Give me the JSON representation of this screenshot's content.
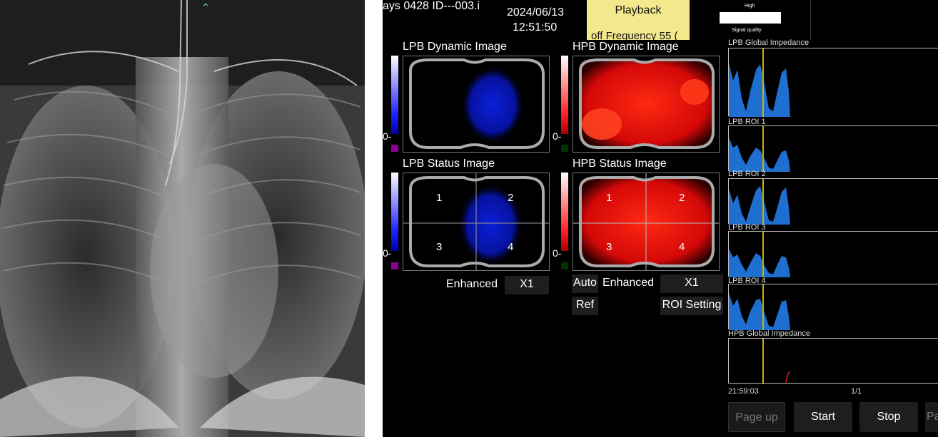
{
  "header": {
    "title": "ays 0428 ID---003.i",
    "date": "2024/06/13",
    "time": "12:51:50",
    "playback_label": "Playback",
    "frequency_text": "off Frequency 55 ("
  },
  "signal_quality": {
    "level_label": "High",
    "label": "Signal quality"
  },
  "panels": {
    "lpb_dynamic": {
      "title": "LPB Dynamic Image",
      "scale_zero": "0-"
    },
    "hpb_dynamic": {
      "title": "HPB Dynamic Image",
      "scale_zero": "0-"
    },
    "lpb_status": {
      "title": "LPB Status Image",
      "scale_zero": "0-",
      "quadrants": [
        "1",
        "2",
        "3",
        "4"
      ]
    },
    "hpb_status": {
      "title": "HPB Status Image",
      "scale_zero": "0-",
      "quadrants": [
        "1",
        "2",
        "3",
        "4"
      ]
    }
  },
  "controls": {
    "lpb_enhanced_label": "Enhanced",
    "lpb_zoom_value": "X1",
    "auto_label": "Auto",
    "hpb_enhanced_label": "Enhanced",
    "hpb_zoom_value": "X1",
    "ref_label": "Ref",
    "roi_setting_label": "ROI Setting"
  },
  "waveforms": {
    "lpb_global": "LPB Global Impedance",
    "roi1": "LPB ROI 1",
    "roi2": "LPB ROI 2",
    "roi3": "LPB ROI 3",
    "roi4": "LPB ROI 4",
    "hpb_global": "HPB Global Impedance",
    "time_label": "21:59:03",
    "page_indicator": "1/1"
  },
  "bottom_buttons": {
    "page_up": "Page up",
    "start": "Start",
    "stop": "Stop",
    "partial": "Pa"
  },
  "colors": {
    "screen_bg": "#000000",
    "playback_bg": "#f3e98c",
    "waveform_fill": "#1e6fd0",
    "cursor": "#c9b400",
    "lpb_image": "#0a1fd8",
    "hpb_image": "#ff1010"
  }
}
